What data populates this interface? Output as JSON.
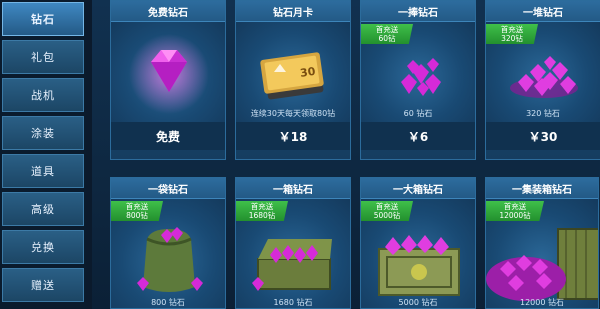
{
  "sidebar": {
    "items": [
      {
        "label": "钻石",
        "active": true
      },
      {
        "label": "礼包",
        "active": false
      },
      {
        "label": "战机",
        "active": false
      },
      {
        "label": "涂装",
        "active": false
      },
      {
        "label": "道具",
        "active": false
      },
      {
        "label": "高级",
        "active": false
      },
      {
        "label": "兑换",
        "active": false
      },
      {
        "label": "赠送",
        "active": false
      }
    ]
  },
  "row1": [
    {
      "title": "免费钻石",
      "price": "免费",
      "icon": "gem-icon"
    },
    {
      "title": "钻石月卡",
      "caption": "连续30天每天领取80钻",
      "price": "￥18",
      "card_text": "30",
      "icon": "month-card-icon"
    },
    {
      "title": "一捧钻石",
      "badge_line1": "首充送",
      "badge_line2": "60钻",
      "caption": "60 钻石",
      "price": "￥6",
      "icon": "gem-handful-icon"
    },
    {
      "title": "一堆钻石",
      "badge_line1": "首充送",
      "badge_line2": "320钻",
      "caption": "320 钻石",
      "price": "￥30",
      "icon": "gem-pile-icon"
    }
  ],
  "row2": [
    {
      "title": "一袋钻石",
      "badge_line1": "首充送",
      "badge_line2": "800钻",
      "caption": "800 钻石",
      "icon": "gem-bag-icon"
    },
    {
      "title": "一箱钻石",
      "badge_line1": "首充送",
      "badge_line2": "1680钻",
      "caption": "1680 钻石",
      "icon": "gem-chest-icon"
    },
    {
      "title": "一大箱钻石",
      "badge_line1": "首充送",
      "badge_line2": "5000钻",
      "caption": "5000 钻石",
      "icon": "gem-crate-icon"
    },
    {
      "title": "一集装箱钻石",
      "badge_line1": "首充送",
      "badge_line2": "12000钻",
      "caption": "12000 钻石",
      "icon": "gem-container-icon"
    }
  ],
  "colors": {
    "gem": "#d62ad8",
    "badge": "#35b541",
    "accent": "#2d6c9e"
  }
}
